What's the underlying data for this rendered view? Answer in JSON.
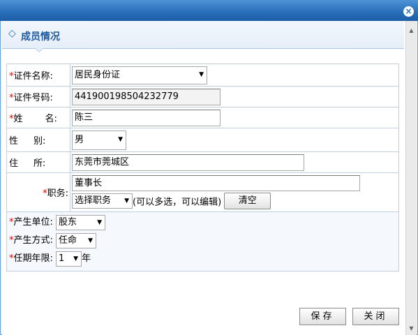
{
  "window": {
    "close_icon": "×"
  },
  "section": {
    "icon": "◇",
    "title": "成员情况"
  },
  "form": {
    "required_mark": "*",
    "id_type": {
      "label": "证件名称:",
      "value": "居民身份证"
    },
    "id_number": {
      "label": "证件号码:",
      "value": "441900198504232779"
    },
    "name": {
      "label_a": "姓",
      "label_b": "名:",
      "value": "陈三"
    },
    "gender": {
      "label_a": "性",
      "label_b": "别:",
      "value": "男"
    },
    "address": {
      "label_a": "住",
      "label_b": "所:",
      "value": "东莞市莞城区"
    },
    "position": {
      "label": "职务",
      "value": "董事长",
      "select_placeholder": "选择职务",
      "hint": "(可以多选，可以编辑)",
      "clear_label": "清空"
    },
    "origin_unit": {
      "label": "产生单位:",
      "value": "股东"
    },
    "origin_method": {
      "label": "产生方式:",
      "value": "任命"
    },
    "term": {
      "label": "任期年限:",
      "value": "1",
      "unit": "年"
    }
  },
  "footer": {
    "save_label": "保存",
    "close_label": "关闭"
  },
  "scrollbar": {
    "up_icon": "▲",
    "down_icon": "▼"
  }
}
